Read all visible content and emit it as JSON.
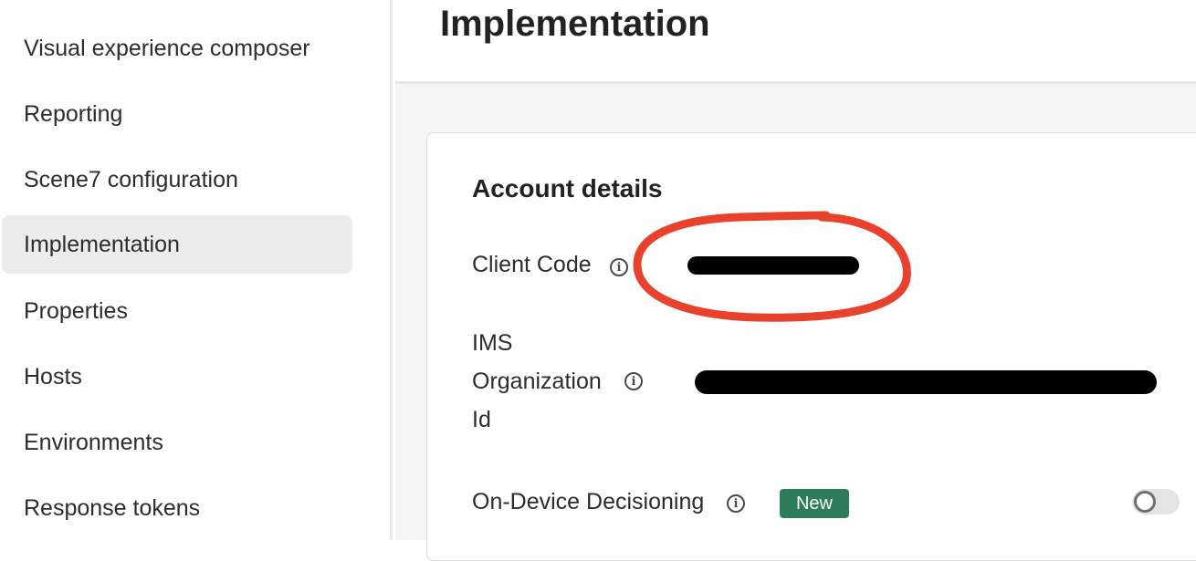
{
  "sidebar": {
    "items": [
      {
        "label": "Visual experience composer"
      },
      {
        "label": "Reporting"
      },
      {
        "label": "Scene7 configuration"
      },
      {
        "label": "Implementation",
        "active": true
      },
      {
        "label": "Properties"
      },
      {
        "label": "Hosts"
      },
      {
        "label": "Environments"
      },
      {
        "label": "Response tokens"
      }
    ]
  },
  "header": {
    "title": "Implementation"
  },
  "account": {
    "title": "Account details",
    "client_code": {
      "label": "Client Code",
      "value_redacted": true
    },
    "ims_org": {
      "label_line1": "IMS",
      "label_line2": "Organization",
      "label_line3": "Id",
      "value_redacted": true
    },
    "on_device": {
      "label": "On-Device Decisioning",
      "badge": "New",
      "enabled": false
    }
  },
  "icons": {
    "info": "info-icon",
    "toggle": "toggle-switch"
  },
  "colors": {
    "badge_bg": "#2d7d5a",
    "annotation": "#e8412c",
    "active_nav": "#ececec"
  }
}
